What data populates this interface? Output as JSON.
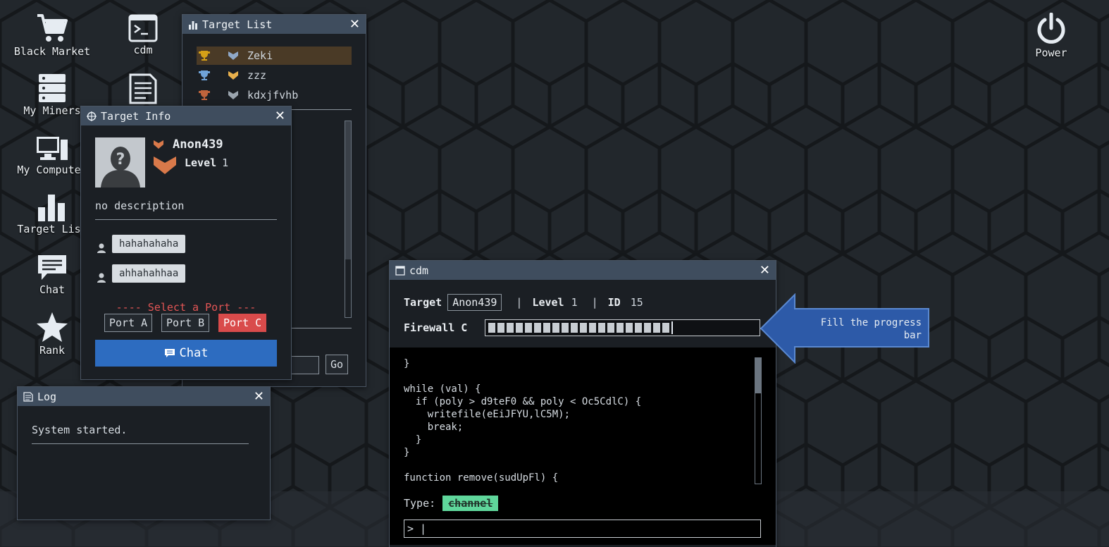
{
  "desktop": {
    "icons": [
      {
        "label": "Black Market",
        "icon": "cart-icon"
      },
      {
        "label": "cdm",
        "icon": "terminal-icon"
      },
      {
        "label": "My Miners",
        "icon": "server-icon"
      },
      {
        "label": "",
        "icon": "notepad-icon"
      },
      {
        "label": "My Computer",
        "icon": "computer-icon"
      },
      {
        "label": "Target List",
        "icon": "bar-chart-icon"
      },
      {
        "label": "Chat",
        "icon": "chat-icon"
      },
      {
        "label": "Rank",
        "icon": "star-icon"
      },
      {
        "label": "Power",
        "icon": "power-icon"
      }
    ]
  },
  "target_list": {
    "title": "Target List",
    "rows": [
      {
        "name": "Zeki",
        "trophy_color": "#d4a017"
      },
      {
        "name": "zzz",
        "trophy_color": "#6fa3d8"
      },
      {
        "name": "kdxjfvhb",
        "trophy_color": "#c0643c"
      }
    ],
    "go_label": "Go"
  },
  "target_info": {
    "title": "Target Info",
    "name": "Anon439",
    "level_label": "Level",
    "level_value": "1",
    "description": "no description",
    "messages": [
      "hahahahaha",
      "ahhahahhaa"
    ],
    "select_port": "---- Select a Port ---",
    "ports": [
      "Port A",
      "Port B",
      "Port C"
    ],
    "active_port": "Port C",
    "chat_label": "Chat"
  },
  "log": {
    "title": "Log",
    "text": "System started."
  },
  "cdm": {
    "title": "cdm",
    "target_label": "Target",
    "target_value": "Anon439",
    "sep": "|",
    "level_label": "Level",
    "level_value": "1",
    "id_label": "ID",
    "id_value": "15",
    "firewall_label": "Firewall C",
    "firewall_progress": 0.7,
    "code": "}\n\nwhile (val) {\n  if (poly > d9teF0 && poly < Oc5CdlC) {\n    writefile(eEiJFYU,lC5M);\n    break;\n  }\n}\n\nfunction remove(sudUpFl) {",
    "type_label": "Type:",
    "type_value": "channel",
    "prompt": "> |"
  },
  "callout": {
    "text": "Fill the progress bar"
  },
  "colors": {
    "accent_blue": "#2d6cc0",
    "active_port_red": "#d94b4b",
    "type_badge_green": "#5fd69b",
    "callout_blue": "#2d5aa8"
  }
}
